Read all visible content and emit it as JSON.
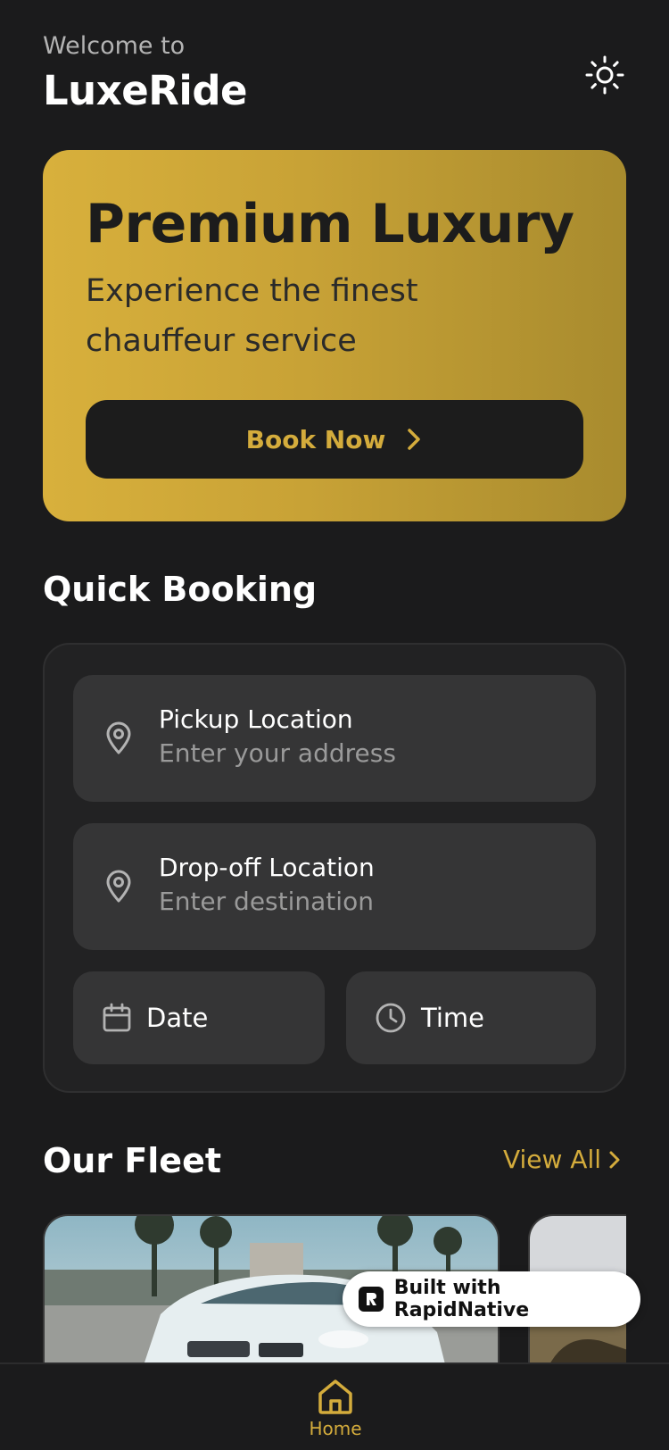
{
  "header": {
    "welcome": "Welcome to",
    "app_name": "LuxeRide",
    "theme_icon": "sun-icon"
  },
  "hero": {
    "title": "Premium Luxury",
    "subtitle": "Experience the finest chauffeur service",
    "cta_label": "Book Now",
    "cta_icon": "chevron-right-icon"
  },
  "quick_booking": {
    "title": "Quick Booking",
    "pickup": {
      "label": "Pickup Location",
      "placeholder": "Enter your address",
      "icon": "map-pin-icon"
    },
    "dropoff": {
      "label": "Drop-off Location",
      "placeholder": "Enter destination",
      "icon": "map-pin-icon"
    },
    "date": {
      "label": "Date",
      "icon": "calendar-icon"
    },
    "time": {
      "label": "Time",
      "icon": "clock-icon"
    }
  },
  "fleet": {
    "title": "Our Fleet",
    "view_all": "View All"
  },
  "badge": {
    "text": "Built with RapidNative"
  },
  "tabbar": {
    "home_label": "Home",
    "home_icon": "home-icon"
  },
  "colors": {
    "accent": "#d4ac3c",
    "background": "#1b1b1c",
    "field": "#353536"
  }
}
